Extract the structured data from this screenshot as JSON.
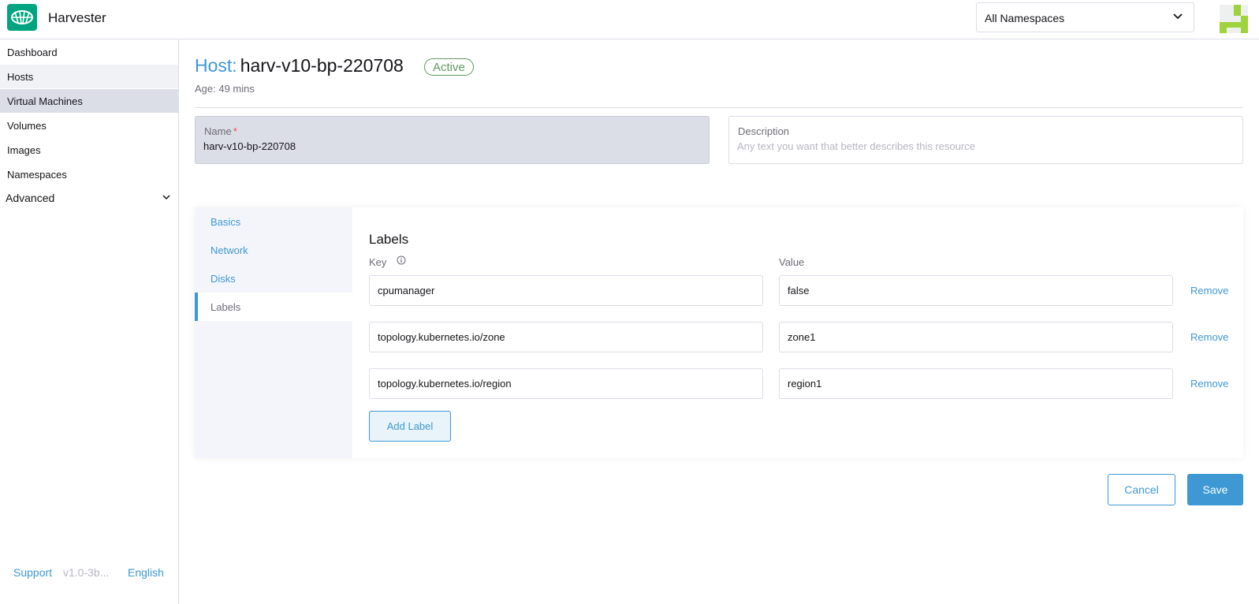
{
  "header": {
    "app_title": "Harvester",
    "namespace_select": {
      "value": "All Namespaces"
    },
    "logo_icon": "harvester-logo-icon",
    "avatar_icon": "user-avatar-icon"
  },
  "sidebar": {
    "items": [
      {
        "label": "Dashboard"
      },
      {
        "label": "Hosts"
      },
      {
        "label": "Virtual Machines"
      },
      {
        "label": "Volumes"
      },
      {
        "label": "Images"
      },
      {
        "label": "Namespaces"
      }
    ],
    "advanced": {
      "label": "Advanced"
    },
    "footer": {
      "support": "Support",
      "version": "v1.0-3b...",
      "language": "English"
    }
  },
  "page": {
    "title_prefix": "Host:",
    "title_name": "harv-v10-bp-220708",
    "status_badge": "Active",
    "age": "Age: 49 mins"
  },
  "form": {
    "name": {
      "label": "Name",
      "required_mark": "*",
      "value": "harv-v10-bp-220708"
    },
    "description": {
      "label": "Description",
      "value": "",
      "placeholder": "Any text you want that better describes this resource"
    }
  },
  "tabs": [
    {
      "label": "Basics"
    },
    {
      "label": "Network"
    },
    {
      "label": "Disks"
    },
    {
      "label": "Labels"
    }
  ],
  "labels_section": {
    "title": "Labels",
    "key_header": "Key",
    "value_header": "Value",
    "rows": [
      {
        "key": "cpumanager",
        "value": "false",
        "remove": "Remove"
      },
      {
        "key": "topology.kubernetes.io/zone",
        "value": "zone1",
        "remove": "Remove"
      },
      {
        "key": "topology.kubernetes.io/region",
        "value": "region1",
        "remove": "Remove"
      }
    ],
    "add_button": "Add Label"
  },
  "actions": {
    "cancel": "Cancel",
    "save": "Save"
  },
  "colors": {
    "accent": "#3d98d3",
    "brand": "#00a580",
    "active_badge": "#5d995d",
    "required": "#f64747"
  }
}
